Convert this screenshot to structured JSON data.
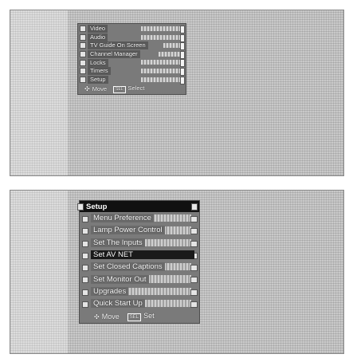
{
  "menu1": {
    "items": [
      "Video",
      "Audio",
      "TV Guide On Screen",
      "Channel Manager",
      "Locks",
      "Timers",
      "Setup"
    ],
    "footer": {
      "move_label": "Move",
      "select_key": "SEL",
      "select_label": "Select"
    }
  },
  "menu2": {
    "title": "Setup",
    "items": [
      "Menu Preference",
      "Lamp Power Control",
      "Set The Inputs",
      "Set AV NET",
      "Set Closed Captions",
      "Set Monitor Out",
      "Upgrades",
      "Quick Start Up"
    ],
    "selected_item": "Set AV NET",
    "footer": {
      "move_label": "Move",
      "set_key": "SEL",
      "set_label": "Set"
    }
  },
  "colors": {
    "menu_bg": "#7a7a7a",
    "highlight": "#1a1a1a",
    "screen_bg": "#c9c9c9"
  }
}
